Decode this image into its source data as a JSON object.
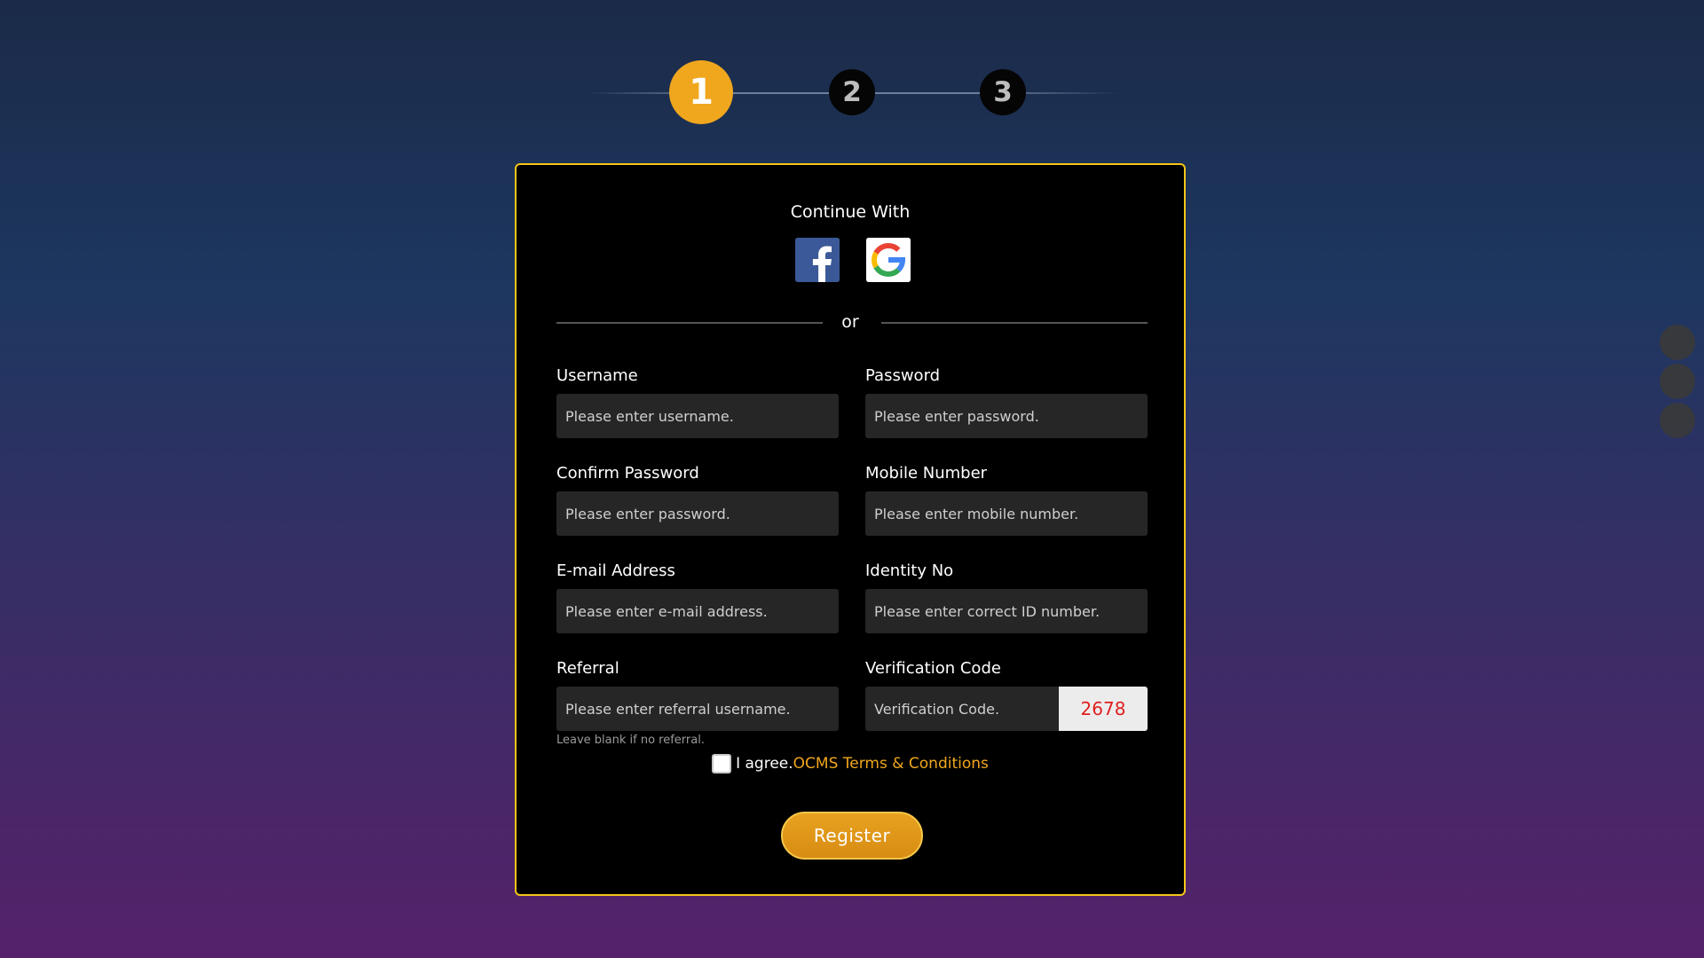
{
  "stepper": {
    "steps": [
      "1",
      "2",
      "3"
    ],
    "active_step": 1,
    "active_color": "#f0a71e"
  },
  "form": {
    "continue_with": "Continue With",
    "social": [
      "facebook-icon",
      "google-icon"
    ],
    "or_label": "or",
    "username": {
      "label": "Username",
      "placeholder": "Please enter username."
    },
    "password": {
      "label": "Password",
      "placeholder": "Please enter password."
    },
    "confirm_password": {
      "label": "Confirm Password",
      "placeholder": "Please enter password."
    },
    "mobile": {
      "label": "Mobile Number",
      "placeholder": "Please enter mobile number."
    },
    "email": {
      "label": "E-mail Address",
      "placeholder": "Please enter e-mail address."
    },
    "identity": {
      "label": "Identity No",
      "placeholder": "Please enter correct ID number."
    },
    "referral": {
      "label": "Referral",
      "placeholder": "Please enter referral username.",
      "hint": "Leave blank if no referral."
    },
    "verification": {
      "label": "Verification Code",
      "placeholder": "Verification Code.",
      "code": "2678"
    },
    "agree_text": "I agree.",
    "terms_link": "OCMS Terms & Conditions",
    "register_label": "Register",
    "accent_color": "#f0a71e",
    "border_color": "#f5c518"
  }
}
